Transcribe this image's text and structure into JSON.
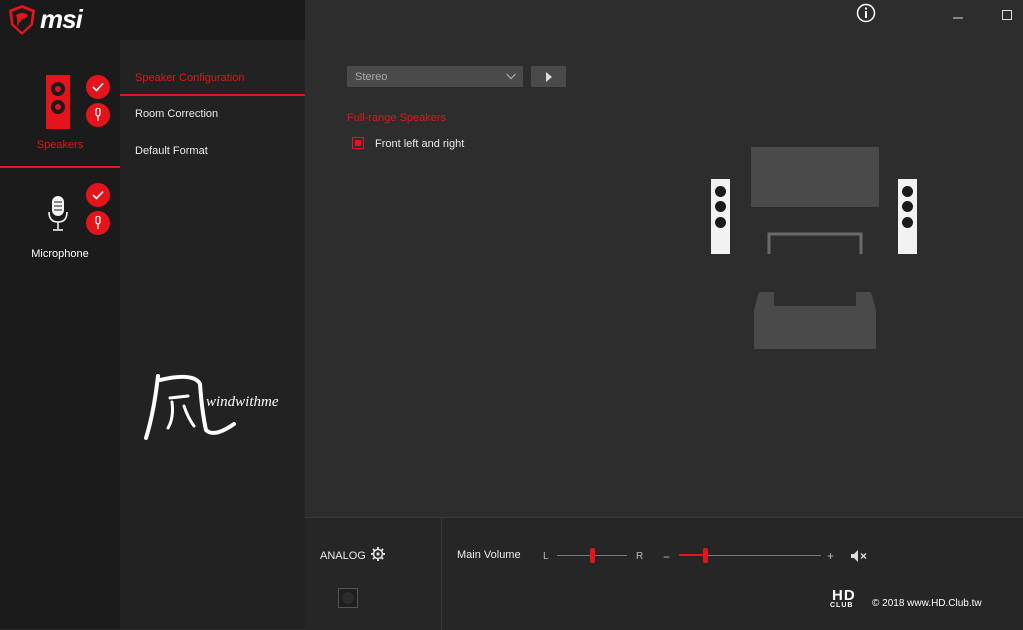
{
  "brand": {
    "name": "msi"
  },
  "window": {
    "info_icon": "info-icon",
    "minimize_icon": "minimize-icon",
    "maximize_icon": "maximize-icon"
  },
  "devices": [
    {
      "label": "Speakers",
      "icon": "speaker-icon",
      "active": true
    },
    {
      "label": "Microphone",
      "icon": "microphone-icon",
      "active": false
    }
  ],
  "submenu": [
    {
      "label": "Speaker Configuration",
      "active": true
    },
    {
      "label": "Room Correction",
      "active": false
    },
    {
      "label": "Default Format",
      "active": false
    }
  ],
  "config": {
    "select_value": "Stereo",
    "section_label": "Full-range Speakers",
    "checkbox_label": "Front left and right",
    "checkbox_checked": true
  },
  "bottom": {
    "analog_label": "ANALOG",
    "volume_label": "Main Volume",
    "balance_left": "L",
    "balance_right": "R",
    "balance_level": 0.5,
    "volume_minus": "−",
    "volume_plus": "+",
    "volume_level": 0.19
  },
  "overlay": {
    "watermark_text": "windwithme",
    "hd_logo": "HD",
    "hd_club": "CLUB",
    "copyright": "© 2018 www.HD.Club.tw"
  },
  "colors": {
    "accent": "#e3141b",
    "background": "#2d2d2d",
    "sidebar": "#1b1b1b"
  }
}
